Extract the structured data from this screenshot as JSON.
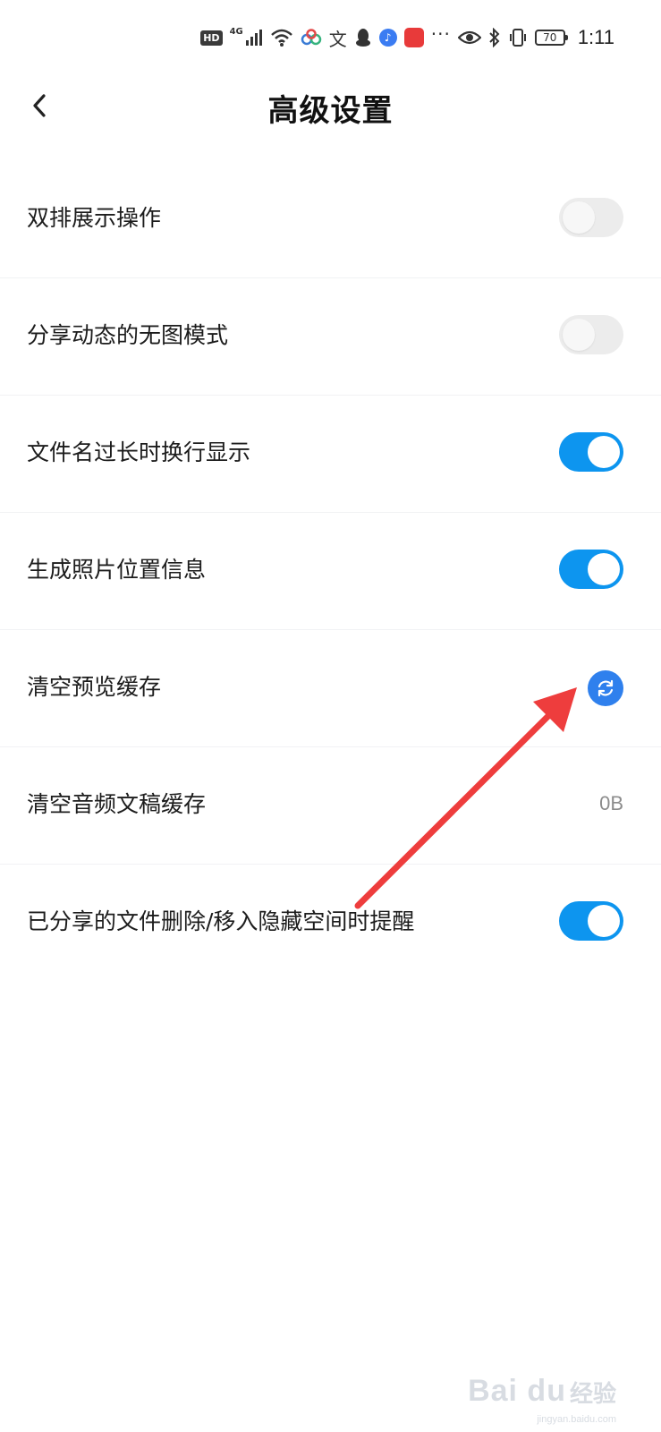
{
  "status_bar": {
    "hd": "HD",
    "network": "4G",
    "wen": "文",
    "more": "···",
    "battery": "70",
    "time": "1:11"
  },
  "header": {
    "title": "高级设置"
  },
  "settings": [
    {
      "label": "双排展示操作",
      "control": "toggle",
      "on": false
    },
    {
      "label": "分享动态的无图模式",
      "control": "toggle",
      "on": false
    },
    {
      "label": "文件名过长时换行显示",
      "control": "toggle",
      "on": true
    },
    {
      "label": "生成照片位置信息",
      "control": "toggle",
      "on": true
    },
    {
      "label": "清空预览缓存",
      "control": "refresh-button"
    },
    {
      "label": "清空音频文稿缓存",
      "control": "value",
      "value": "0B"
    },
    {
      "label": "已分享的文件删除/移入隐藏空间时提醒",
      "control": "toggle",
      "on": true
    }
  ],
  "colors": {
    "toggle_on": "#0d95ef",
    "toggle_off": "#ececec",
    "refresh": "#2f80ed",
    "annotation_arrow": "#ee3d3d"
  },
  "watermark": {
    "brand": "Bai du",
    "cn": "经验",
    "url": "jingyan.baidu.com"
  }
}
